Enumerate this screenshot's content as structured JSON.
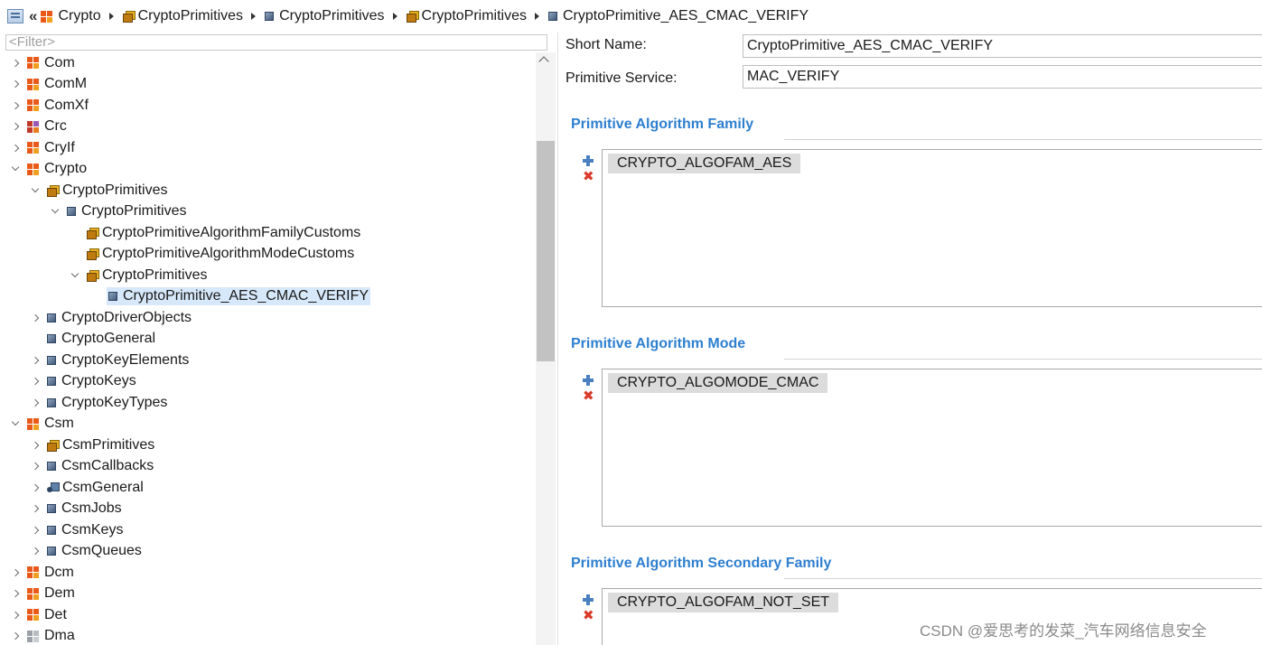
{
  "breadcrumb": {
    "back_glyph": "«",
    "items": [
      {
        "label": "Crypto",
        "icon": "module-icon"
      },
      {
        "label": "CryptoPrimitives",
        "icon": "folder-icon"
      },
      {
        "label": "CryptoPrimitives",
        "icon": "container-icon"
      },
      {
        "label": "CryptoPrimitives",
        "icon": "folder-icon"
      },
      {
        "label": "CryptoPrimitive_AES_CMAC_VERIFY",
        "icon": "container-icon"
      }
    ]
  },
  "tree": {
    "filter_placeholder": "<Filter>",
    "rows": [
      {
        "label": "Com",
        "depth": 0,
        "state": "closed",
        "icon": "module"
      },
      {
        "label": "ComM",
        "depth": 0,
        "state": "closed",
        "icon": "module"
      },
      {
        "label": "ComXf",
        "depth": 0,
        "state": "closed",
        "icon": "module"
      },
      {
        "label": "Crc",
        "depth": 0,
        "state": "closed",
        "icon": "module-purple"
      },
      {
        "label": "CryIf",
        "depth": 0,
        "state": "closed",
        "icon": "module"
      },
      {
        "label": "Crypto",
        "depth": 0,
        "state": "open",
        "icon": "module"
      },
      {
        "label": "CryptoPrimitives",
        "depth": 1,
        "state": "open",
        "icon": "folder"
      },
      {
        "label": "CryptoPrimitives",
        "depth": 2,
        "state": "open",
        "icon": "container"
      },
      {
        "label": "CryptoPrimitiveAlgorithmFamilyCustoms",
        "depth": 3,
        "state": "none",
        "icon": "folder"
      },
      {
        "label": "CryptoPrimitiveAlgorithmModeCustoms",
        "depth": 3,
        "state": "none",
        "icon": "folder"
      },
      {
        "label": "CryptoPrimitives",
        "depth": 3,
        "state": "open",
        "icon": "folder"
      },
      {
        "label": "CryptoPrimitive_AES_CMAC_VERIFY",
        "depth": 4,
        "state": "none",
        "icon": "container",
        "selected": true
      },
      {
        "label": "CryptoDriverObjects",
        "depth": 1,
        "state": "closed",
        "icon": "container"
      },
      {
        "label": "CryptoGeneral",
        "depth": 1,
        "state": "none",
        "icon": "container"
      },
      {
        "label": "CryptoKeyElements",
        "depth": 1,
        "state": "closed",
        "icon": "container"
      },
      {
        "label": "CryptoKeys",
        "depth": 1,
        "state": "closed",
        "icon": "container"
      },
      {
        "label": "CryptoKeyTypes",
        "depth": 1,
        "state": "closed",
        "icon": "container"
      },
      {
        "label": "Csm",
        "depth": 0,
        "state": "open",
        "icon": "module"
      },
      {
        "label": "CsmPrimitives",
        "depth": 1,
        "state": "closed",
        "icon": "folder"
      },
      {
        "label": "CsmCallbacks",
        "depth": 1,
        "state": "closed",
        "icon": "container"
      },
      {
        "label": "CsmGeneral",
        "depth": 1,
        "state": "closed",
        "icon": "general"
      },
      {
        "label": "CsmJobs",
        "depth": 1,
        "state": "closed",
        "icon": "container"
      },
      {
        "label": "CsmKeys",
        "depth": 1,
        "state": "closed",
        "icon": "container"
      },
      {
        "label": "CsmQueues",
        "depth": 1,
        "state": "closed",
        "icon": "container"
      },
      {
        "label": "Dcm",
        "depth": 0,
        "state": "closed",
        "icon": "module"
      },
      {
        "label": "Dem",
        "depth": 0,
        "state": "closed",
        "icon": "module"
      },
      {
        "label": "Det",
        "depth": 0,
        "state": "closed",
        "icon": "module"
      },
      {
        "label": "Dma",
        "depth": 0,
        "state": "closed",
        "icon": "gray"
      }
    ]
  },
  "form": {
    "short_name": {
      "label": "Short Name:",
      "value": "CryptoPrimitive_AES_CMAC_VERIFY"
    },
    "primitive_service": {
      "label": "Primitive Service:",
      "value": "MAC_VERIFY"
    },
    "sections": [
      {
        "title": "Primitive Algorithm Family",
        "item": "CRYPTO_ALGOFAM_AES"
      },
      {
        "title": "Primitive Algorithm Mode",
        "item": "CRYPTO_ALGOMODE_CMAC"
      },
      {
        "title": "Primitive Algorithm Secondary Family",
        "item": "CRYPTO_ALGOFAM_NOT_SET"
      }
    ],
    "remove_glyph": "✖"
  },
  "watermark": "CSDN @爱思考的发菜_汽车网络信息安全"
}
